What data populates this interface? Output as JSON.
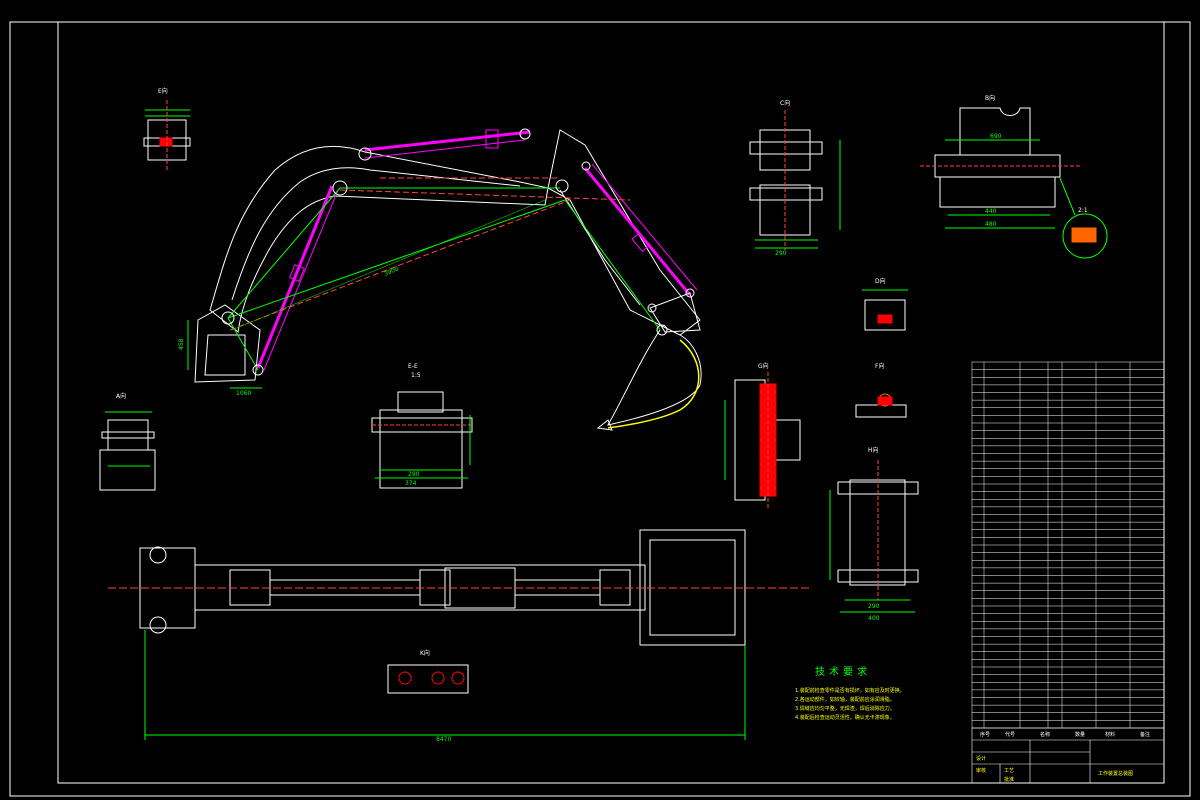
{
  "drawing": {
    "overall_dimension": "8470",
    "reach_dimension": "3900",
    "bucket_dim": "458",
    "base_dim": "1060"
  },
  "section_labels": {
    "e_view": "E向",
    "e_scale": "1:5",
    "a_view": "A向",
    "b_view": "B向",
    "c_view": "C向",
    "d_view": "D向",
    "ee_section": "E-E",
    "ee_scale": "1:5",
    "f_view": "F向",
    "g_view": "G向",
    "h_view": "H向",
    "detail_scale": "2:1",
    "k_view": "K向"
  },
  "view_dims": {
    "b_width": "690",
    "b_inner": "440",
    "b_total": "480",
    "c_dim": "290",
    "ee_total": "374",
    "ee_inner": "290",
    "h_total": "400",
    "h_inner": "290"
  },
  "technical_notes": {
    "title": "技术要求",
    "lines": [
      "1.装配前检查零件是否有损坏，如有应及时更换。",
      "2.各运动部件，如铰轴，装配前应涂润滑脂。",
      "3.焊缝应均匀平整，无焊渣，焊后消除应力。",
      "4.装配后检查运动灵活性，确认无卡滞现象。"
    ]
  },
  "title_block": {
    "drawing_title": "工作装置总装图",
    "labels": [
      "序号",
      "代号",
      "名称",
      "数量",
      "材料",
      "备注"
    ],
    "sign_labels": [
      "设计",
      "审核",
      "工艺",
      "批准"
    ]
  }
}
